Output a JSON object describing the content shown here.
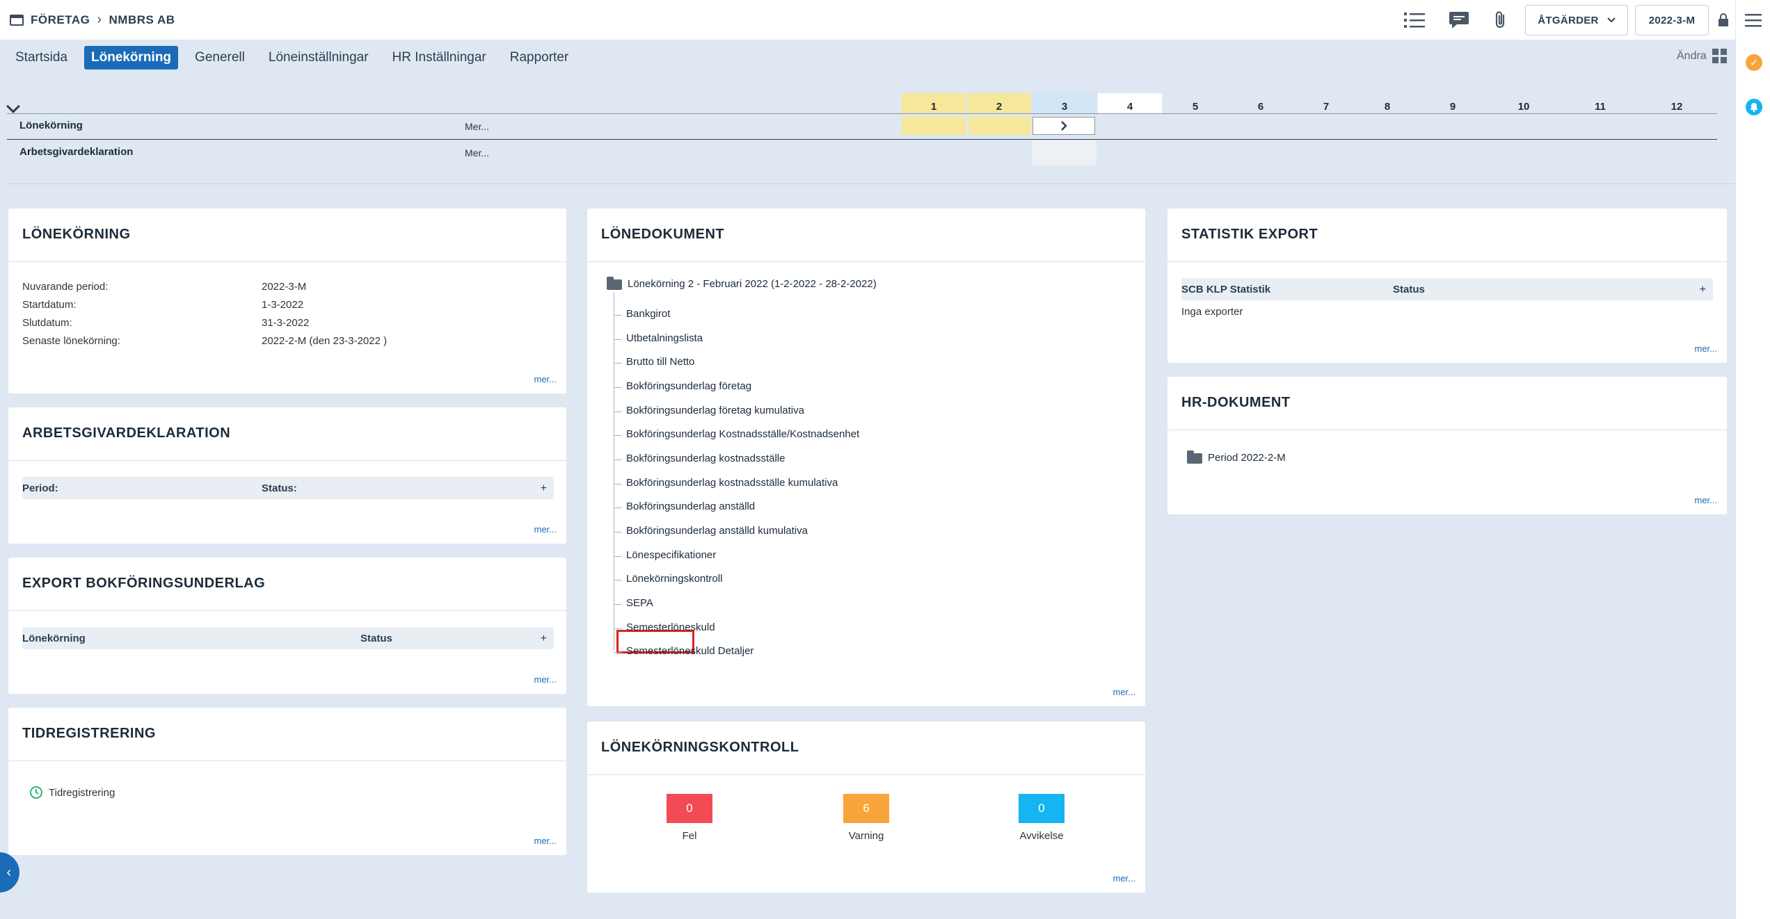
{
  "topbar": {
    "company_label": "FÖRETAG",
    "company_name": "NMBRS AB",
    "actions_label": "ÅTGÄRDER",
    "period_label": "2022-3-M"
  },
  "tabs": [
    "Startsida",
    "Lönekörning",
    "Generell",
    "Löneinställningar",
    "HR Inställningar",
    "Rapporter"
  ],
  "active_tab": "Lönekörning",
  "andra_label": "Ändra",
  "timeline": {
    "months": [
      "1",
      "2",
      "3",
      "4",
      "5",
      "6",
      "7",
      "8",
      "9",
      "10",
      "11",
      "12"
    ],
    "rows": [
      {
        "label": "Lönekörning",
        "more": "Mer..."
      },
      {
        "label": "Arbetsgivardeklaration",
        "more": "Mer..."
      }
    ]
  },
  "lonekorning": {
    "title": "LÖNEKÖRNING",
    "rows": [
      {
        "label": "Nuvarande period:",
        "value": "2022-3-M"
      },
      {
        "label": "Startdatum:",
        "value": "1-3-2022"
      },
      {
        "label": "Slutdatum:",
        "value": "31-3-2022"
      },
      {
        "label": "Senaste lönekörning:",
        "value": "2022-2-M (den 23-3-2022 )"
      }
    ],
    "more": "mer..."
  },
  "arbetsgivar": {
    "title": "ARBETSGIVARDEKLARATION",
    "col1": "Period:",
    "col2": "Status:",
    "plus": "+",
    "more": "mer..."
  },
  "export_bokf": {
    "title": "EXPORT BOKFÖRINGSUNDERLAG",
    "col1": "Lönekörning",
    "col2": "Status",
    "plus": "+",
    "more": "mer..."
  },
  "tidreg": {
    "title": "TIDREGISTRERING",
    "item": "Tidregistrering",
    "more": "mer..."
  },
  "lonedokument": {
    "title": "LÖNEDOKUMENT",
    "folder": "Lönekörning 2 - Februari 2022 (1-2-2022 - 28-2-2022)",
    "items": [
      "Bankgirot",
      "Utbetalningslista",
      "Brutto till Netto",
      "Bokföringsunderlag företag",
      "Bokföringsunderlag företag kumulativa",
      "Bokföringsunderlag Kostnadsställe/Kostnadsenhet",
      "Bokföringsunderlag kostnadsställe",
      "Bokföringsunderlag kostnadsställe kumulativa",
      "Bokföringsunderlag anställd",
      "Bokföringsunderlag anställd kumulativa",
      "Lönespecifikationer",
      "Lönekörningskontroll",
      "SEPA",
      "Semesterlöneskuld",
      "Semesterlöneskuld Detaljer"
    ],
    "more": "mer..."
  },
  "kontroll": {
    "title": "LÖNEKÖRNINGSKONTROLL",
    "items": [
      {
        "value": "0",
        "label": "Fel",
        "color": "#f24b55"
      },
      {
        "value": "6",
        "label": "Varning",
        "color": "#f7a53a"
      },
      {
        "value": "0",
        "label": "Avvikelse",
        "color": "#16b4f0"
      }
    ],
    "more": "mer..."
  },
  "statistik": {
    "title": "STATISTIK EXPORT",
    "col1": "SCB KLP Statistik",
    "col2": "Status",
    "plus": "+",
    "empty": "Inga exporter",
    "more": "mer..."
  },
  "hrdok": {
    "title": "HR-DOKUMENT",
    "folder": "Period 2022-2-M",
    "more": "mer..."
  },
  "colors": {
    "accent": "#1a6bb8",
    "highlight": "#e02020",
    "month_done": "#f6e79a",
    "month_current": "#d3e6f7"
  }
}
